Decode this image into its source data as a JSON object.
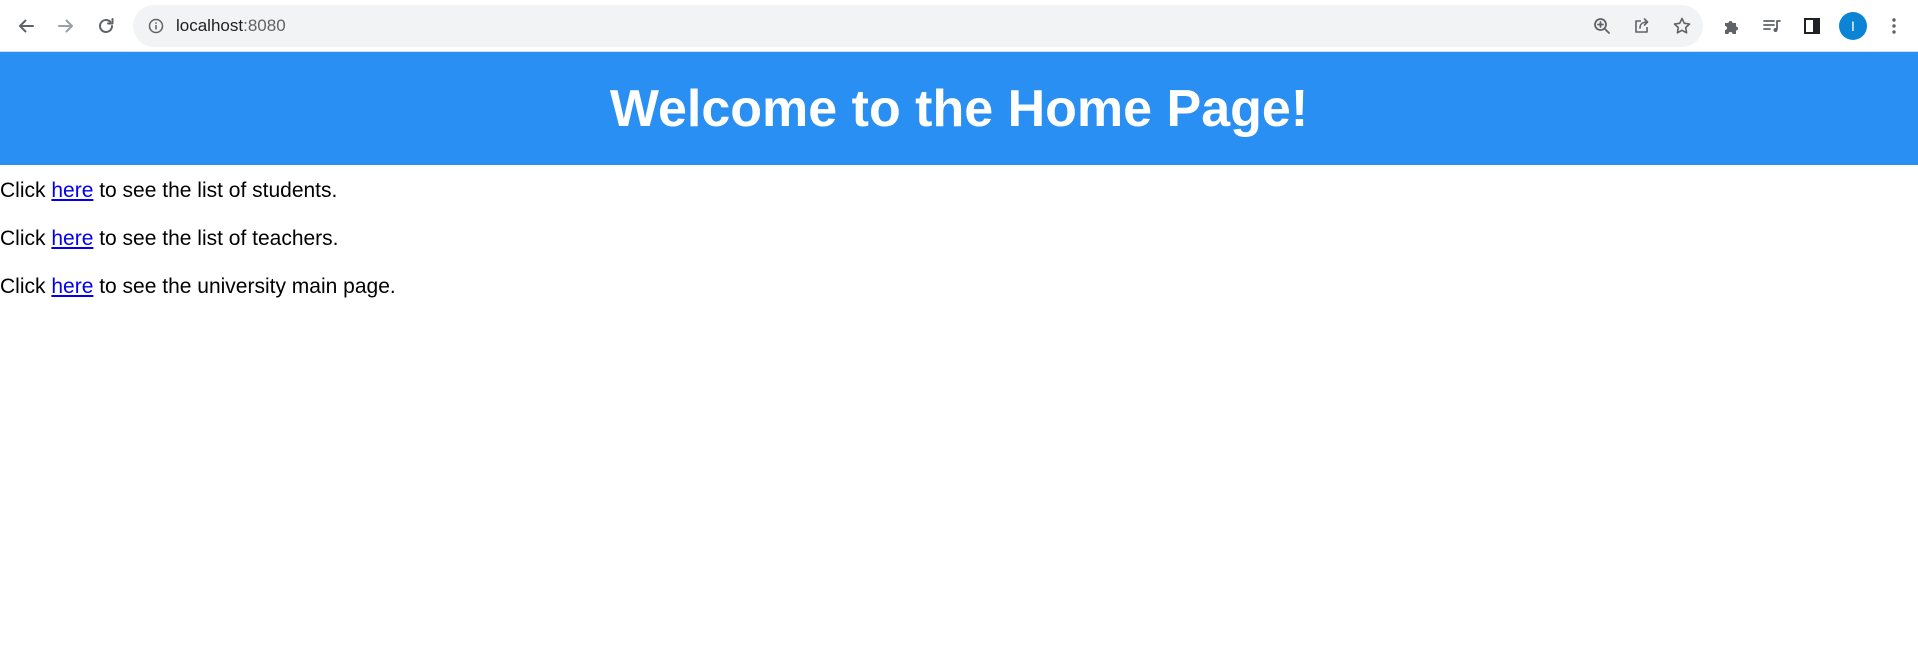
{
  "browser": {
    "url_host": "localhost",
    "url_port": ":8080",
    "profile_initial": "I",
    "accent_color": "#0b84d6",
    "icons": {
      "back": "arrow-left-icon",
      "forward": "arrow-right-icon",
      "reload": "reload-icon",
      "site_info": "info-icon",
      "zoom": "zoom-in-icon",
      "share": "share-icon",
      "bookmark": "star-icon",
      "extensions": "puzzle-icon",
      "media": "media-queue-icon",
      "side_panel": "side-panel-icon",
      "menu": "kebab-menu-icon"
    }
  },
  "page": {
    "header_color": "#2a8ff2",
    "title": "Welcome to the Home Page!",
    "lines": [
      {
        "prefix": "Click ",
        "link": "here",
        "suffix": " to see the list of students."
      },
      {
        "prefix": "Click ",
        "link": "here",
        "suffix": " to see the list of teachers."
      },
      {
        "prefix": "Click ",
        "link": "here",
        "suffix": " to see the university main page."
      }
    ]
  }
}
